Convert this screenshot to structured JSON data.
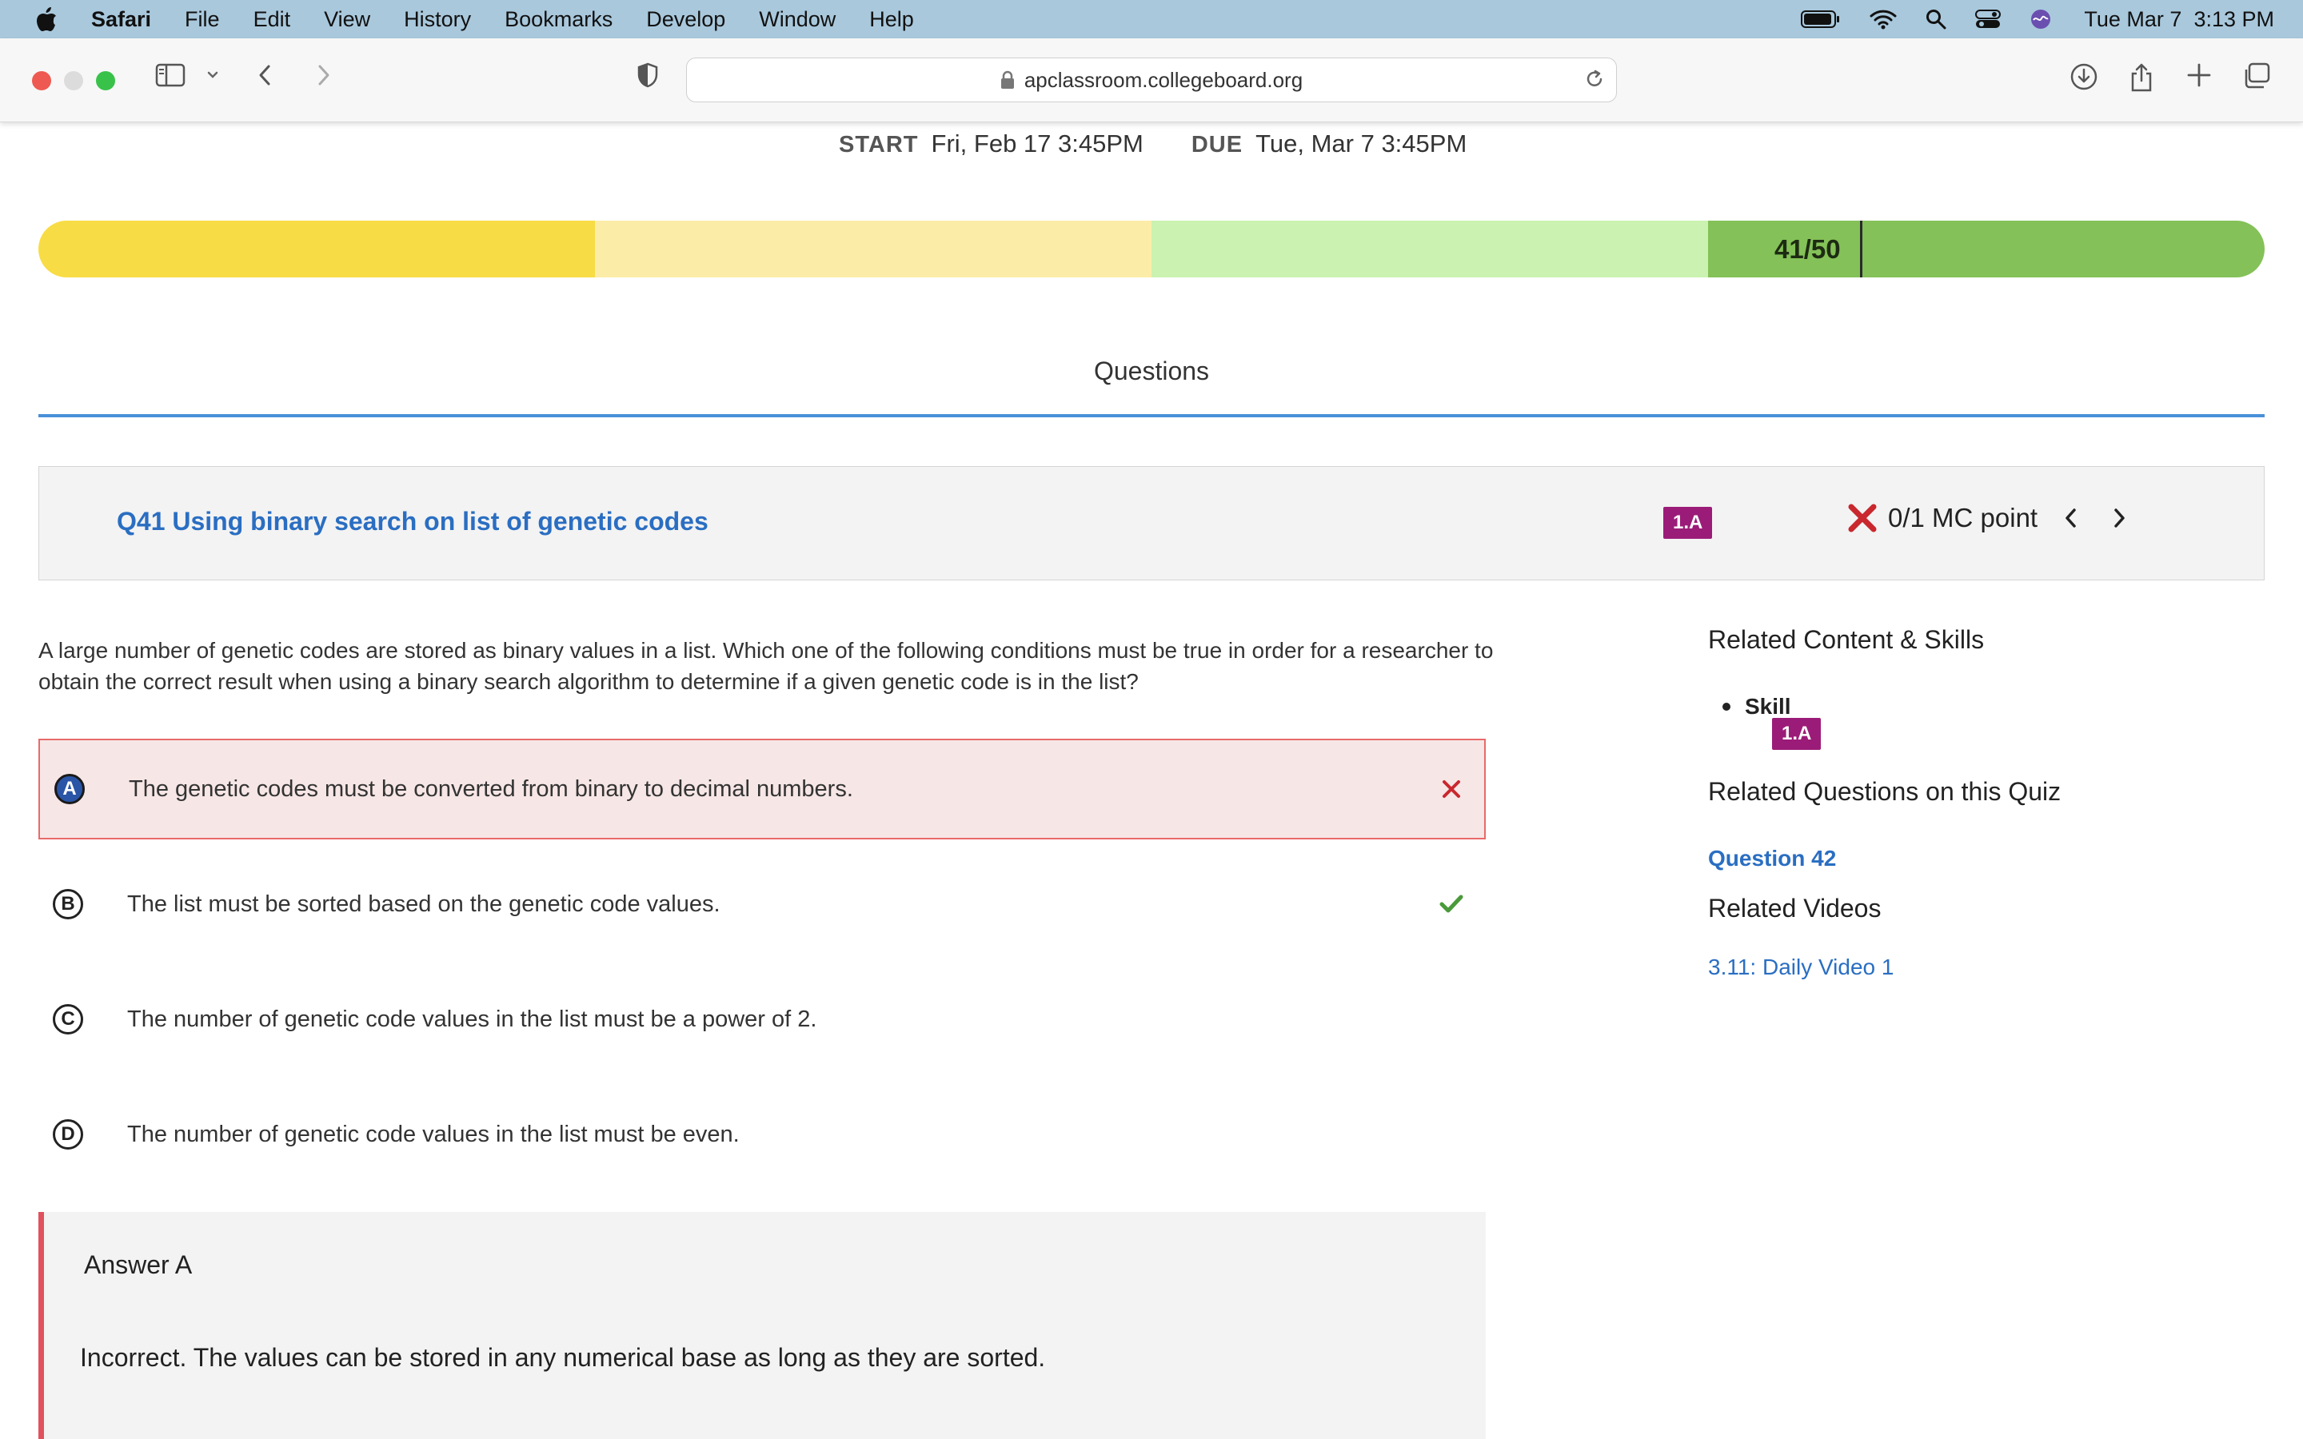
{
  "menubar": {
    "app": "Safari",
    "menus": [
      "File",
      "Edit",
      "View",
      "History",
      "Bookmarks",
      "Develop",
      "Window",
      "Help"
    ],
    "date": "Tue Mar 7",
    "time": "3:13 PM"
  },
  "browser": {
    "url": "apclassroom.collegeboard.org"
  },
  "schedule": {
    "start_label": "START",
    "start_value": "Fri, Feb 17 3:45PM",
    "due_label": "DUE",
    "due_value": "Tue, Mar 7 3:45PM"
  },
  "progress": {
    "score_text": "41/50",
    "current": 41,
    "total": 50,
    "segment_colors": [
      "#f8dc45",
      "#fbeca8",
      "#cbf2b0",
      "#84c158"
    ]
  },
  "tabs": {
    "active": "Questions"
  },
  "question": {
    "title": "Q41 Using binary search on list of genetic codes",
    "skill_badge": "1.A",
    "points": "0/1 MC point",
    "status_icon": "x-icon",
    "prompt": "A large number of genetic codes are stored as binary values in a list. Which one of the following conditions must be true in order for a researcher to obtain the correct result when using a binary search algorithm to determine if a given genetic code is in the list?",
    "choices": [
      {
        "letter": "A",
        "text": "The genetic codes must be converted from binary to decimal numbers.",
        "selected": true,
        "mark": "wrong"
      },
      {
        "letter": "B",
        "text": "The list must be sorted based on the genetic code values.",
        "selected": false,
        "mark": "correct"
      },
      {
        "letter": "C",
        "text": "The number of genetic code values in the list must be a power of 2.",
        "selected": false,
        "mark": ""
      },
      {
        "letter": "D",
        "text": "The number of genetic code values in the list must be even.",
        "selected": false,
        "mark": ""
      }
    ]
  },
  "explanation": {
    "title": "Answer A",
    "body": "Incorrect. The values can be stored in any numerical base as long as they are sorted."
  },
  "sidebar": {
    "related_content_title": "Related Content & Skills",
    "skill_label": "Skill",
    "skill_badge": "1.A",
    "related_questions_title": "Related Questions on this Quiz",
    "related_question_link": "Question 42",
    "related_videos_title": "Related Videos",
    "related_video_link": "3.11: Daily Video 1"
  },
  "colors": {
    "link": "#2a6ec2",
    "badge": "#9b1c78",
    "wrong": "#c8282e",
    "correct": "#4a9a3a"
  }
}
